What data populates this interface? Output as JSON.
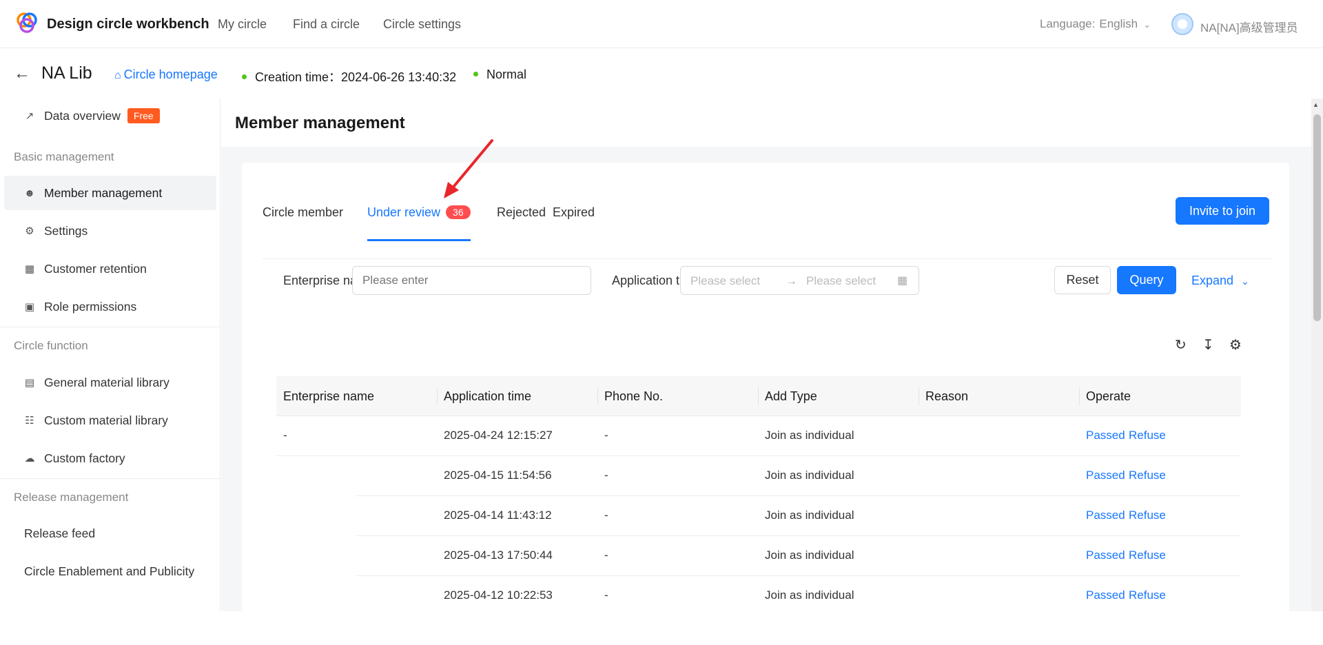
{
  "app": {
    "brand": "Design circle workbench",
    "nav": [
      "My circle",
      "Find a circle",
      "Circle settings"
    ],
    "language_label": "Language:",
    "language_value": "English",
    "username": "NA[NA]高级管理员"
  },
  "subheader": {
    "library_name": "NA Lib",
    "homepage_link": "Circle homepage",
    "creation_time": "Creation time：2024-06-26 13:40:32",
    "status": "Normal"
  },
  "sidebar": {
    "data_overview": "Data overview",
    "free_badge": "Free",
    "group_basic": "Basic management",
    "member_management": "Member management",
    "settings": "Settings",
    "customer_retention": "Customer retention",
    "role_permissions": "Role permissions",
    "group_circle": "Circle function",
    "general_material": "General material library",
    "custom_material": "Custom material library",
    "custom_factory": "Custom factory",
    "group_release": "Release management",
    "release_feed": "Release feed",
    "enablement": "Circle Enablement and Publicity"
  },
  "page": {
    "title": "Member management"
  },
  "tabs": {
    "circle_member": "Circle member",
    "under_review": "Under review",
    "under_review_count": "36",
    "rejected": "Rejected",
    "expired": "Expired",
    "invite": "Invite to join"
  },
  "filters": {
    "enterprise_label": "Enterprise na",
    "enterprise_placeholder": "Please enter",
    "application_label": "Application t",
    "range_start": "Please select",
    "range_end": "Please select",
    "reset": "Reset",
    "query": "Query",
    "expand": "Expand"
  },
  "table": {
    "columns": [
      "Enterprise name",
      "Application time",
      "Phone No.",
      "Add Type",
      "Reason",
      "Operate"
    ],
    "rows": [
      {
        "enterprise": "-",
        "time": "2025-04-24 12:15:27",
        "phone": "-",
        "type": "Join as individual",
        "pass": "Passed",
        "refuse": "Refuse"
      },
      {
        "enterprise": "",
        "time": "2025-04-15 11:54:56",
        "phone": "-",
        "type": "Join as individual",
        "pass": "Passed",
        "refuse": "Refuse"
      },
      {
        "enterprise": "",
        "time": "2025-04-14 11:43:12",
        "phone": "-",
        "type": "Join as individual",
        "pass": "Passed",
        "refuse": "Refuse"
      },
      {
        "enterprise": "",
        "time": "2025-04-13 17:50:44",
        "phone": "-",
        "type": "Join as individual",
        "pass": "Passed",
        "refuse": "Refuse"
      },
      {
        "enterprise": "",
        "time": "2025-04-12 10:22:53",
        "phone": "-",
        "type": "Join as individual",
        "pass": "Passed",
        "refuse": "Refuse"
      }
    ]
  },
  "colors": {
    "primary": "#1677ff",
    "badge": "#ff4d4f",
    "free_badge": "#ff5a1f",
    "status_dot": "#52c41a",
    "annotation_arrow": "#e8262b"
  }
}
